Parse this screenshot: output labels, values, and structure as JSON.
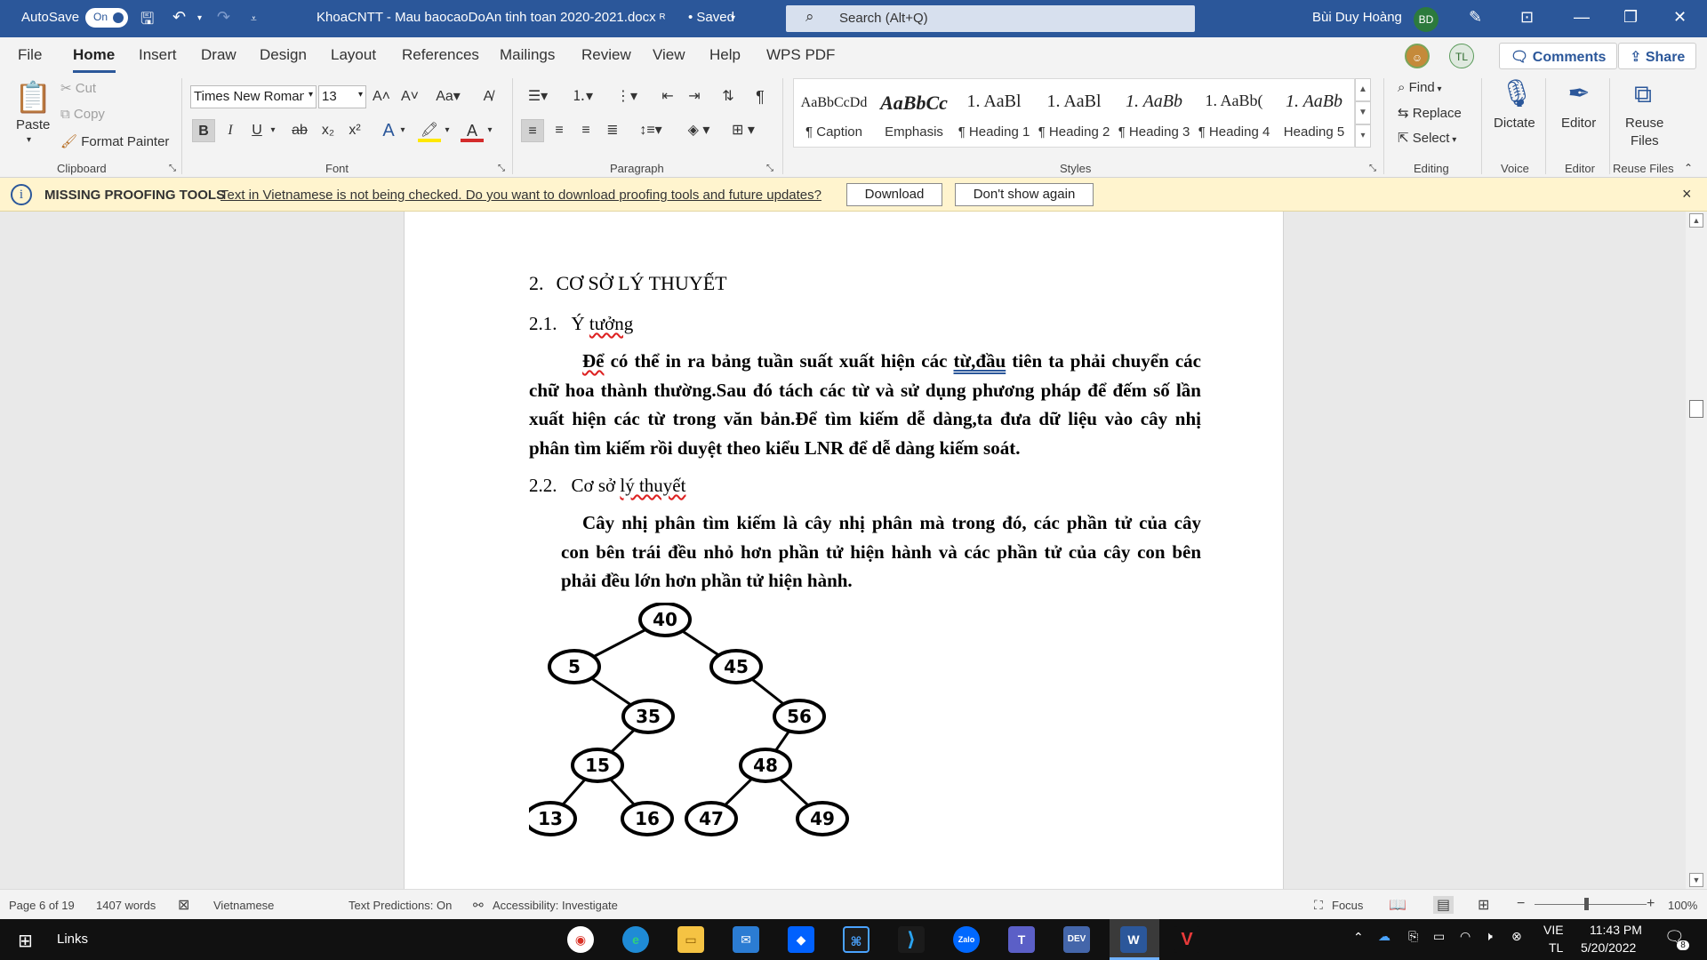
{
  "titlebar": {
    "autosave_label": "AutoSave",
    "autosave_state": "On",
    "doc_title": "KhoaCNTT - Mau baocaoDoAn tinh toan 2020-2021.docx",
    "save_status": "• Saved",
    "search_placeholder": "Search (Alt+Q)",
    "user_name": "Bùi Duy Hoàng",
    "user_initials": "BD",
    "accent_color": "#2b579a"
  },
  "menu": {
    "tabs": [
      "File",
      "Home",
      "Insert",
      "Draw",
      "Design",
      "Layout",
      "References",
      "Mailings",
      "Review",
      "View",
      "Help",
      "WPS PDF"
    ],
    "active_tab": "Home",
    "coauthor_initials": "TL",
    "comments_label": "Comments",
    "share_label": "Share"
  },
  "ribbon": {
    "clipboard": {
      "paste_label": "Paste",
      "cut_label": "Cut",
      "copy_label": "Copy",
      "format_painter_label": "Format Painter",
      "group_label": "Clipboard"
    },
    "font": {
      "font_name": "Times New Roman",
      "font_size": "13",
      "group_label": "Font",
      "bold": "B",
      "italic": "I",
      "underline": "U",
      "strike": "ab",
      "subscript": "x₂",
      "superscript": "x²",
      "change_case": "Aa",
      "grow": "A^",
      "shrink": "Aˇ"
    },
    "paragraph": {
      "group_label": "Paragraph"
    },
    "styles": {
      "group_label": "Styles",
      "items": [
        {
          "sample": "AaBbCcDd",
          "name": "¶ Caption"
        },
        {
          "sample": "AaBbCc",
          "name": "Emphasis"
        },
        {
          "sample": "1. AaBl",
          "name": "¶ Heading 1"
        },
        {
          "sample": "1. AaBl",
          "name": "¶ Heading 2"
        },
        {
          "sample": "1. AaBb",
          "name": "¶ Heading 3"
        },
        {
          "sample": "1. AaBb(",
          "name": "¶ Heading 4"
        },
        {
          "sample": "1. AaBb",
          "name": "Heading 5"
        }
      ]
    },
    "editing": {
      "find_label": "Find",
      "replace_label": "Replace",
      "select_label": "Select",
      "group_label": "Editing"
    },
    "voice": {
      "dictate_label": "Dictate",
      "group_label": "Voice"
    },
    "editor": {
      "editor_label": "Editor",
      "group_label": "Editor"
    },
    "reuse": {
      "reuse_label_1": "Reuse",
      "reuse_label_2": "Files",
      "group_label": "Reuse Files"
    }
  },
  "infobar": {
    "title": "MISSING PROOFING TOOLS",
    "message": "Text in Vietnamese is not being checked. Do you want to download proofing tools and future updates?",
    "download_label": "Download",
    "dismiss_label": "Don't show again",
    "close_glyph": "×"
  },
  "document": {
    "heading_2_num": "2.",
    "heading_2_text": "CƠ SỞ LÝ THUYẾT",
    "heading_21_num": "2.1.",
    "heading_21_text_a": "Ý ",
    "heading_21_text_b": "tưởng",
    "para1": {
      "line1_a": "Để",
      "line1_b": " có thể in ra bảng tuần suất xuất hiện các ",
      "line1_c": "từ,đầu",
      "line1_d": " tiên ta phải chuyển các",
      "line2": "chữ hoa thành thường.Sau đó tách các từ và sử dụng phương pháp để đếm số lần",
      "line3": "xuất hiện các từ trong văn bản.Để tìm kiếm dễ dàng,ta đưa dữ liệu vào cây nhị",
      "line4": "phân tìm kiếm rồi duyệt theo kiểu LNR để dễ dàng kiếm soát."
    },
    "heading_22_num": "2.2.",
    "heading_22_text_a": "Cơ sở ",
    "heading_22_text_b": "lý thuyết",
    "para2": {
      "line1": "Cây nhị phân tìm kiếm là cây nhị phân mà trong đó, các phần tử của cây",
      "line2": "con bên trái đều nhỏ hơn phần tử hiện hành và các phần tử của cây con bên",
      "line3": "phải đều lớn hơn phần tử hiện hành."
    },
    "tree_nodes": [
      "40",
      "5",
      "45",
      "35",
      "56",
      "15",
      "48",
      "13",
      "16",
      "47",
      "49"
    ],
    "tree_edges": [
      [
        "40",
        "5"
      ],
      [
        "40",
        "45"
      ],
      [
        "5",
        "35"
      ],
      [
        "45",
        "56"
      ],
      [
        "35",
        "15"
      ],
      [
        "56",
        "48"
      ],
      [
        "15",
        "13"
      ],
      [
        "15",
        "16"
      ],
      [
        "48",
        "47"
      ],
      [
        "48",
        "49"
      ]
    ]
  },
  "statusbar": {
    "page": "Page 6 of 19",
    "words": "1407 words",
    "language": "Vietnamese",
    "text_predictions": "Text Predictions: On",
    "accessibility": "Accessibility: Investigate",
    "focus": "Focus",
    "zoom": "100%"
  },
  "taskbar": {
    "links_label": "Links",
    "lang_1": "VIE",
    "lang_2": "TL",
    "time": "11:43 PM",
    "date": "5/20/2022",
    "notif_count": "8",
    "apps": [
      "chrome",
      "edge",
      "file-explorer",
      "mail",
      "dropbox",
      "bookmark",
      "vscode",
      "zalo",
      "teams",
      "devc",
      "word",
      "wps"
    ]
  }
}
